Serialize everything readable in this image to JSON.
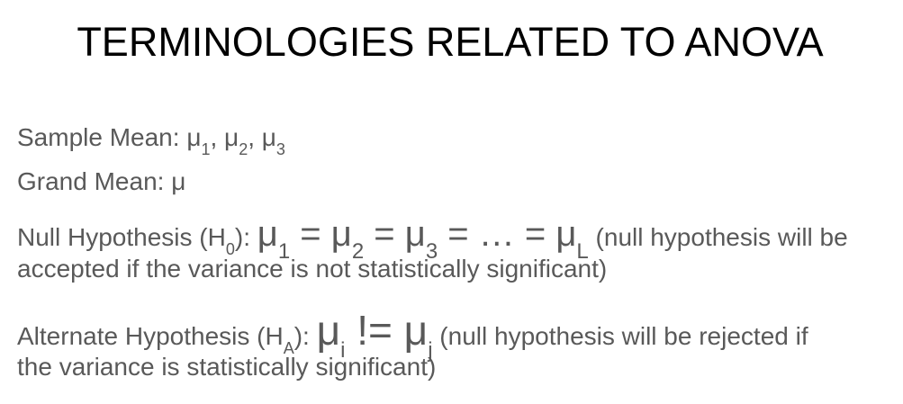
{
  "title": "TERMINOLOGIES RELATED TO ANOVA",
  "sample_mean": {
    "label": "Sample Mean: ",
    "symbol": "μ",
    "subs": [
      "1",
      "2",
      "3"
    ],
    "sep": ", "
  },
  "grand_mean": {
    "label": "Grand Mean: μ"
  },
  "null_hypothesis": {
    "label_prefix": "Null Hypothesis (H",
    "label_sub": "0",
    "label_suffix": "): ",
    "mu": "μ",
    "eq": " = ",
    "subs": [
      "1",
      "2",
      "3",
      "L"
    ],
    "ellipsis": "…",
    "note_line1": " (null hypothesis will be",
    "note_line2": "accepted if the variance is not statistically significant)"
  },
  "alternate_hypothesis": {
    "label_prefix": "Alternate Hypothesis (H",
    "label_sub": "A",
    "label_suffix": "): ",
    "mu": "μ",
    "neq": " != ",
    "sub_i": "i",
    "sub_j": "j",
    "note_line1": " (null hypothesis will be rejected if",
    "note_line2": "the variance is statistically significant)"
  }
}
